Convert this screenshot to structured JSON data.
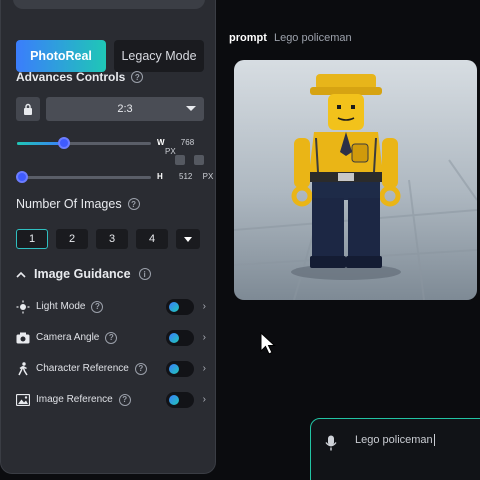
{
  "modes": {
    "active": "PhotoReal",
    "inactive": "Legacy Mode"
  },
  "advanced": {
    "title": "Advances Controls",
    "help": "?"
  },
  "aspect": {
    "value": "2:3"
  },
  "width": {
    "axis": "W",
    "value": "768",
    "unit": "PX",
    "fraction": 0.35
  },
  "height": {
    "axis": "H",
    "value": "512",
    "unit": "PX",
    "fraction": 0.04
  },
  "images": {
    "title": "Number Of Images",
    "help": "?",
    "options": [
      "1",
      "2",
      "3",
      "4"
    ],
    "selected": "1"
  },
  "guidance": {
    "title": "Image Guidance",
    "info": "i",
    "items": [
      {
        "label": "Light Mode",
        "icon": "light-mode-icon",
        "help": "?"
      },
      {
        "label": "Camera Angle",
        "icon": "camera-icon",
        "help": "?"
      },
      {
        "label": "Character Reference",
        "icon": "person-walk-icon",
        "help": "?"
      },
      {
        "label": "Image Reference",
        "icon": "image-icon",
        "help": "?"
      }
    ]
  },
  "prompt": {
    "key": "prompt",
    "value": "Lego policeman"
  },
  "input": {
    "value": "Lego policeman"
  },
  "colors": {
    "accent_start": "#3b7dfc",
    "accent_end": "#1fc7b6",
    "input_border": "#22c3a3"
  }
}
